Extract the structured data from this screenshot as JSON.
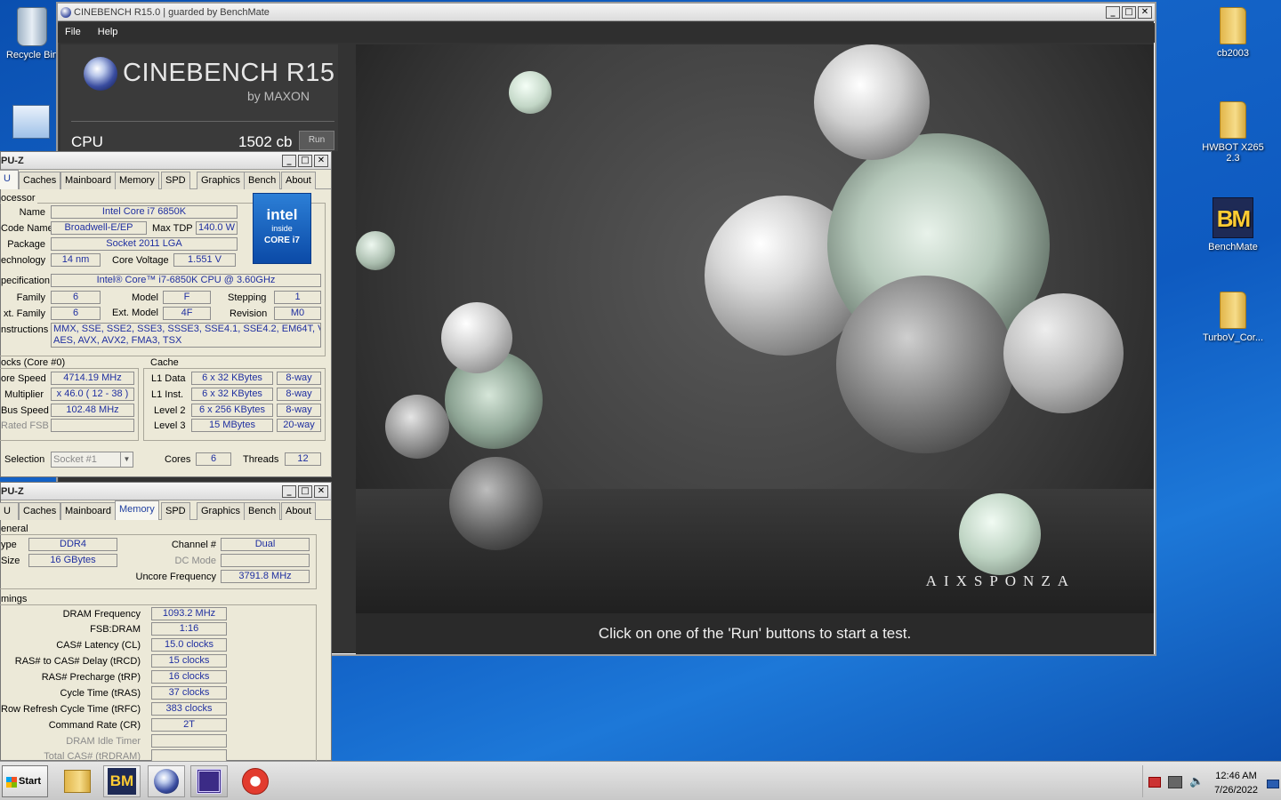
{
  "desktop": {
    "icons_left": [
      {
        "label": "Recycle Bin"
      }
    ],
    "icons_right": [
      {
        "label": "cb2003"
      },
      {
        "label": "HWBOT X265 2.3"
      },
      {
        "label": "BenchMate"
      },
      {
        "label": "TurboV_Cor..."
      }
    ]
  },
  "cinebench": {
    "title": "CINEBENCH R15.0 | guarded by BenchMate",
    "menu": [
      "File",
      "Help"
    ],
    "logo_text": "CINEBENCH R15",
    "logo_by": "by MAXON",
    "cpu_label": "CPU",
    "cpu_score": "1502 cb",
    "run_label": "Run",
    "brand": "AIXSPONZA",
    "status": "Click on one of the 'Run' buttons to start a test."
  },
  "cpuz1": {
    "title": "PU-Z",
    "tabs": [
      "U",
      "Caches",
      "Mainboard",
      "Memory",
      "SPD",
      "Graphics",
      "Bench",
      "About"
    ],
    "processor": {
      "group": "ocessor",
      "name_label": "Name",
      "name": "Intel Core i7 6850K",
      "codename_label": "Code Name",
      "codename": "Broadwell-E/EP",
      "maxtdp_label": "Max TDP",
      "maxtdp": "140.0 W",
      "package_label": "Package",
      "package": "Socket 2011 LGA",
      "tech_label": "echnology",
      "tech": "14 nm",
      "voltage_label": "Core Voltage",
      "voltage": "1.551 V",
      "spec_label": "pecification",
      "spec": "Intel® Core™ i7-6850K CPU @ 3.60GHz",
      "family_label": "Family",
      "family": "6",
      "model_label": "Model",
      "model": "F",
      "stepping_label": "Stepping",
      "stepping": "1",
      "extfamily_label": "xt. Family",
      "extfamily": "6",
      "extmodel_label": "Ext. Model",
      "extmodel": "4F",
      "revision_label": "Revision",
      "revision": "M0",
      "instr_label": "nstructions",
      "instr_line1": "MMX, SSE, SSE2, SSE3, SSSE3, SSE4.1, SSE4.2, EM64T, VT-x,",
      "instr_line2": "AES, AVX, AVX2, FMA3, TSX",
      "intel_logo": "intel",
      "intel_inside": "inside",
      "intel_core": "CORE i7"
    },
    "clocks": {
      "group": "ocks (Core #0)",
      "speed_label": "ore Speed",
      "speed": "4714.19 MHz",
      "mult_label": "Multiplier",
      "mult": "x 46.0 ( 12 - 38 )",
      "bus_label": "Bus Speed",
      "bus": "102.48 MHz",
      "fsb_label": "Rated FSB",
      "fsb": ""
    },
    "cache": {
      "group": "Cache",
      "rows": [
        {
          "label": "L1 Data",
          "size": "6 x 32 KBytes",
          "way": "8-way"
        },
        {
          "label": "L1 Inst.",
          "size": "6 x 32 KBytes",
          "way": "8-way"
        },
        {
          "label": "Level 2",
          "size": "6 x 256 KBytes",
          "way": "8-way"
        },
        {
          "label": "Level 3",
          "size": "15 MBytes",
          "way": "20-way"
        }
      ]
    },
    "selection_label": "Selection",
    "selection": "Socket #1",
    "cores_label": "Cores",
    "cores": "6",
    "threads_label": "Threads",
    "threads": "12"
  },
  "cpuz2": {
    "title": "PU-Z",
    "tabs": [
      "U",
      "Caches",
      "Mainboard",
      "Memory",
      "SPD",
      "Graphics",
      "Bench",
      "About"
    ],
    "general": {
      "group": "eneral",
      "type_label": "ype",
      "type": "DDR4",
      "size_label": "Size",
      "size": "16 GBytes",
      "channel_label": "Channel #",
      "channel": "Dual",
      "dcmode_label": "DC Mode",
      "dcmode": "",
      "uncore_label": "Uncore Frequency",
      "uncore": "3791.8 MHz"
    },
    "timings": {
      "group": "mings",
      "rows": [
        {
          "label": "DRAM Frequency",
          "value": "1093.2 MHz",
          "gray": false
        },
        {
          "label": "FSB:DRAM",
          "value": "1:16",
          "gray": false
        },
        {
          "label": "CAS# Latency (CL)",
          "value": "15.0 clocks",
          "gray": false
        },
        {
          "label": "RAS# to CAS# Delay (tRCD)",
          "value": "15 clocks",
          "gray": false
        },
        {
          "label": "RAS# Precharge (tRP)",
          "value": "16 clocks",
          "gray": false
        },
        {
          "label": "Cycle Time (tRAS)",
          "value": "37 clocks",
          "gray": false
        },
        {
          "label": "Row Refresh Cycle Time (tRFC)",
          "value": "383 clocks",
          "gray": false
        },
        {
          "label": "Command Rate (CR)",
          "value": "2T",
          "gray": false
        },
        {
          "label": "DRAM Idle Timer",
          "value": "",
          "gray": true
        },
        {
          "label": "Total CAS# (tRDRAM)",
          "value": "",
          "gray": true
        }
      ]
    }
  },
  "taskbar": {
    "start_label": "Start",
    "bm_label": "BM",
    "time": "12:46 AM",
    "date": "7/26/2022"
  }
}
